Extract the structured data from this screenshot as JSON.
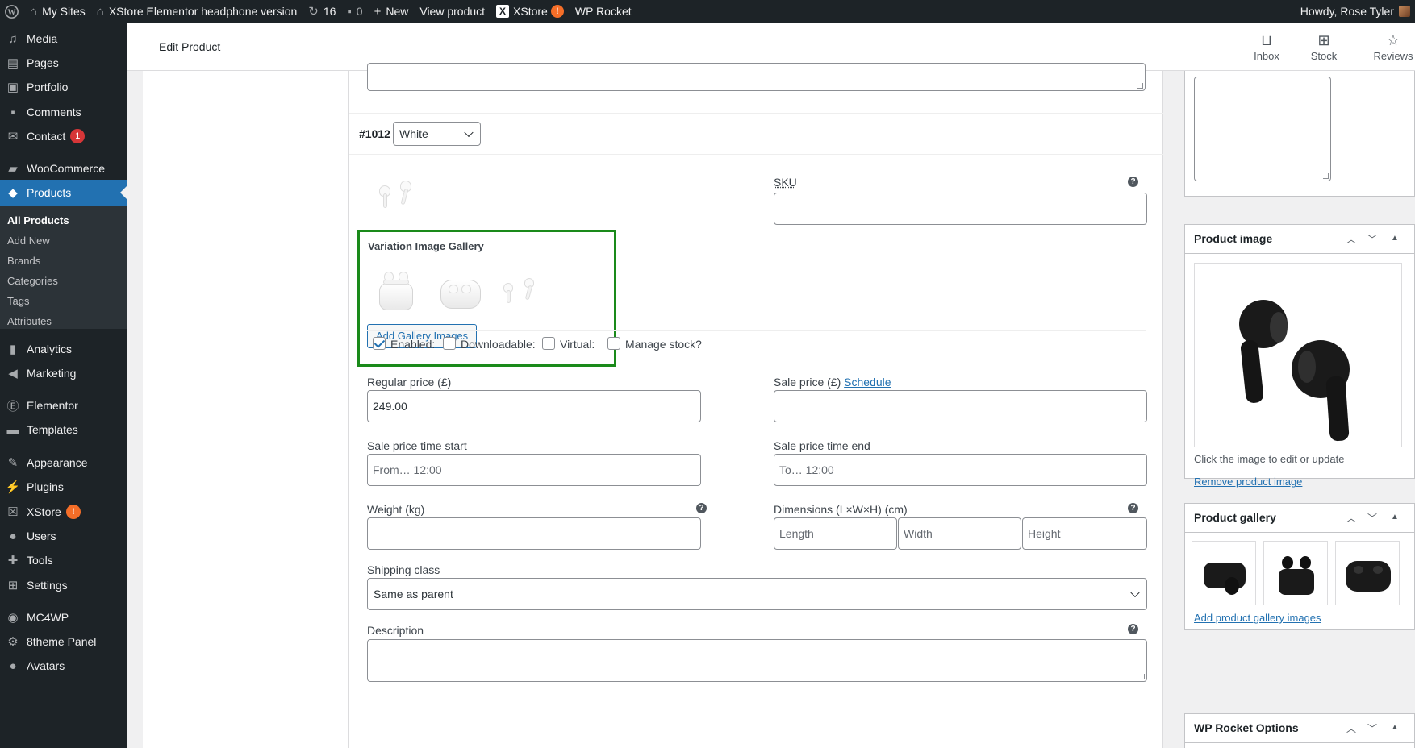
{
  "adminbar": {
    "my_sites": "My Sites",
    "site_name": "XStore Elementor headphone version",
    "updates_count": "16",
    "comments_count": "0",
    "new_label": "New",
    "view_product": "View product",
    "xstore_label": "XStore",
    "xstore_badge": "!",
    "wp_rocket": "WP Rocket",
    "howdy": "Howdy, Rose Tyler"
  },
  "sidebar": {
    "items": [
      {
        "label": "Media",
        "icon": "media-icon"
      },
      {
        "label": "Pages",
        "icon": "pages-icon"
      },
      {
        "label": "Portfolio",
        "icon": "portfolio-icon"
      },
      {
        "label": "Comments",
        "icon": "comments-icon"
      },
      {
        "label": "Contact",
        "icon": "mail-icon",
        "badge": "1"
      },
      {
        "label": "WooCommerce",
        "icon": "woocommerce-icon"
      },
      {
        "label": "Products",
        "icon": "products-icon"
      },
      {
        "label": "Analytics",
        "icon": "analytics-icon"
      },
      {
        "label": "Marketing",
        "icon": "marketing-icon"
      },
      {
        "label": "Elementor",
        "icon": "elementor-icon"
      },
      {
        "label": "Templates",
        "icon": "templates-icon"
      },
      {
        "label": "Appearance",
        "icon": "appearance-icon"
      },
      {
        "label": "Plugins",
        "icon": "plugins-icon"
      },
      {
        "label": "XStore",
        "icon": "xstore-icon",
        "badge": "!"
      },
      {
        "label": "Users",
        "icon": "users-icon"
      },
      {
        "label": "Tools",
        "icon": "tools-icon"
      },
      {
        "label": "Settings",
        "icon": "settings-icon"
      },
      {
        "label": "MC4WP",
        "icon": "mc4wp-icon"
      },
      {
        "label": "8theme Panel",
        "icon": "gear-icon"
      },
      {
        "label": "Avatars",
        "icon": "avatars-icon"
      }
    ],
    "submenu": [
      "All Products",
      "Add New",
      "Brands",
      "Categories",
      "Tags",
      "Attributes"
    ]
  },
  "topbar": {
    "title": "Edit Product",
    "actions": [
      "Inbox",
      "Stock",
      "Reviews"
    ]
  },
  "variation": {
    "id": "#1012",
    "attribute_value": "White",
    "sku_label": "SKU",
    "gallery_title": "Variation Image Gallery",
    "add_gallery_button": "Add Gallery Images",
    "enabled_label": "Enabled:",
    "downloadable_label": "Downloadable:",
    "virtual_label": "Virtual:",
    "manage_stock_label": "Manage stock?",
    "enabled_checked": true,
    "regular_price_label": "Regular price (£)",
    "regular_price_value": "249.00",
    "sale_price_label": "Sale price (£)",
    "schedule_link": "Schedule",
    "sale_start_label": "Sale price time start",
    "sale_start_placeholder": "From… 12:00",
    "sale_end_label": "Sale price time end",
    "sale_end_placeholder": "To… 12:00",
    "weight_label": "Weight (kg)",
    "dimensions_label": "Dimensions (L×W×H) (cm)",
    "length_placeholder": "Length",
    "width_placeholder": "Width",
    "height_placeholder": "Height",
    "shipping_class_label": "Shipping class",
    "shipping_class_value": "Same as parent",
    "description_label": "Description"
  },
  "right": {
    "product_image_title": "Product image",
    "image_help": "Click the image to edit or update",
    "remove_image": "Remove product image",
    "product_gallery_title": "Product gallery",
    "add_gallery_images": "Add product gallery images",
    "wp_rocket_title": "WP Rocket Options"
  },
  "colors": {
    "accent": "#2271b1",
    "highlight_box": "#1a8a1a",
    "admin_dark": "#1d2327",
    "badge_orange": "#f56e28",
    "badge_red": "#d63638"
  }
}
